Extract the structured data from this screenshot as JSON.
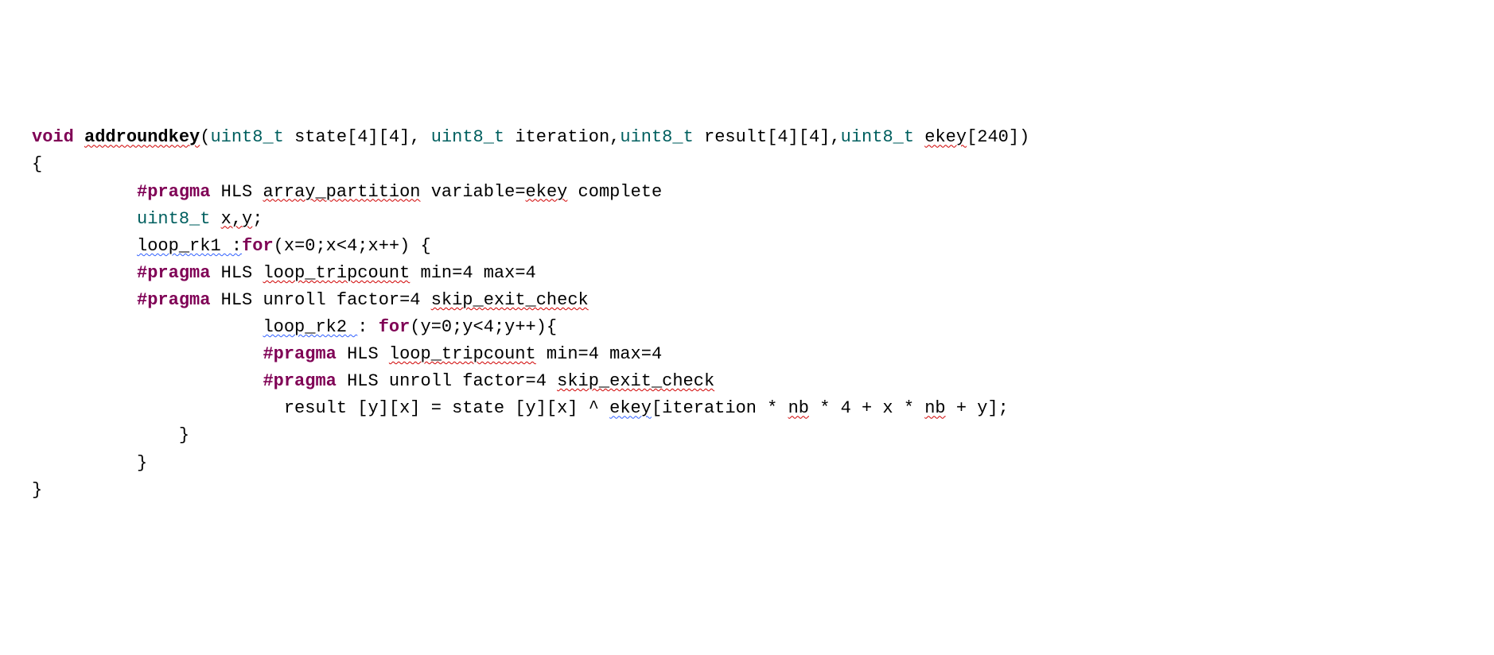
{
  "code": {
    "sig": {
      "void": "void",
      "fn": "addroundkey",
      "uint8_1": "uint8_t",
      "p1": " state[4][4], ",
      "uint8_2": "uint8_t",
      "p2": " iteration,",
      "uint8_3": "uint8_t",
      "p3": " result[4][4],",
      "uint8_4": "uint8_t",
      "ekey": "ekey",
      "p4": "[240])"
    },
    "brace_open": "{",
    "l1": {
      "indent": "          ",
      "pragma": "#pragma",
      "hls": " HLS ",
      "ap": "array_partition",
      "rest": " variable=",
      "ekey": "ekey",
      "comp": " complete"
    },
    "l2": {
      "indent": "          ",
      "uint8": "uint8_t",
      "sp": " ",
      "xy": "x,y",
      "semi": ";"
    },
    "l3": {
      "indent": "          ",
      "label": "loop_rk1 :",
      "for": "for",
      "rest": "(x=0;x<4;x++) {"
    },
    "l4": {
      "indent": "          ",
      "pragma": "#pragma",
      "hls": " HLS ",
      "tc": "loop_tripcount",
      "rest": " min=4 max=4"
    },
    "l5": {
      "indent": "          ",
      "pragma": "#pragma",
      "hls": " HLS unroll factor=4 ",
      "sec": "skip_exit_check"
    },
    "l6": {
      "indent": "                      ",
      "label": "loop_rk2 ",
      "colon_sp": ": ",
      "for": "for",
      "rest": "(y=0;y<4;y++){"
    },
    "l7": {
      "indent": "                      ",
      "pragma": "#pragma",
      "hls": " HLS ",
      "tc": "loop_tripcount",
      "rest": " min=4 max=4"
    },
    "l8": {
      "indent": "                      ",
      "pragma": "#pragma",
      "hls": " HLS unroll factor=4 ",
      "sec": "skip_exit_check"
    },
    "l9": {
      "indent": "                        ",
      "a": "result [y][x] = state [y][x] ^ ",
      "ekey": "ekey",
      "b": "[iteration * ",
      "nb1": "nb",
      "c": " * 4 + x * ",
      "nb2": "nb",
      "d": " + y];"
    },
    "l10": {
      "indent": "              ",
      "brace": "}"
    },
    "l11": {
      "indent": "          ",
      "brace": "}"
    },
    "brace_close": "}"
  }
}
